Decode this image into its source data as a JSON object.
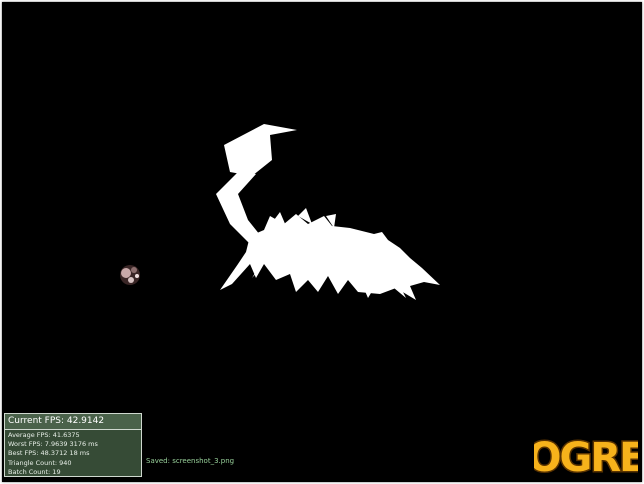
{
  "stats": {
    "current_fps": "Current  FPS:  42.9142",
    "lines": [
      "Average  FPS:  41.6375",
      "Worst  FPS:  7.9639  3176  ms",
      "Best  FPS:  48.3712  18  ms",
      "Triangle  Count:  940",
      "Batch  Count:  19"
    ]
  },
  "status": {
    "saved_message": "Saved:  screenshot_3.png"
  },
  "logo": {
    "text": "OGRE",
    "fill_color": "#f7b21b",
    "outline_color": "#5a3300"
  },
  "scene": {
    "background_color": "#000000",
    "creature_color": "#ffffff"
  }
}
